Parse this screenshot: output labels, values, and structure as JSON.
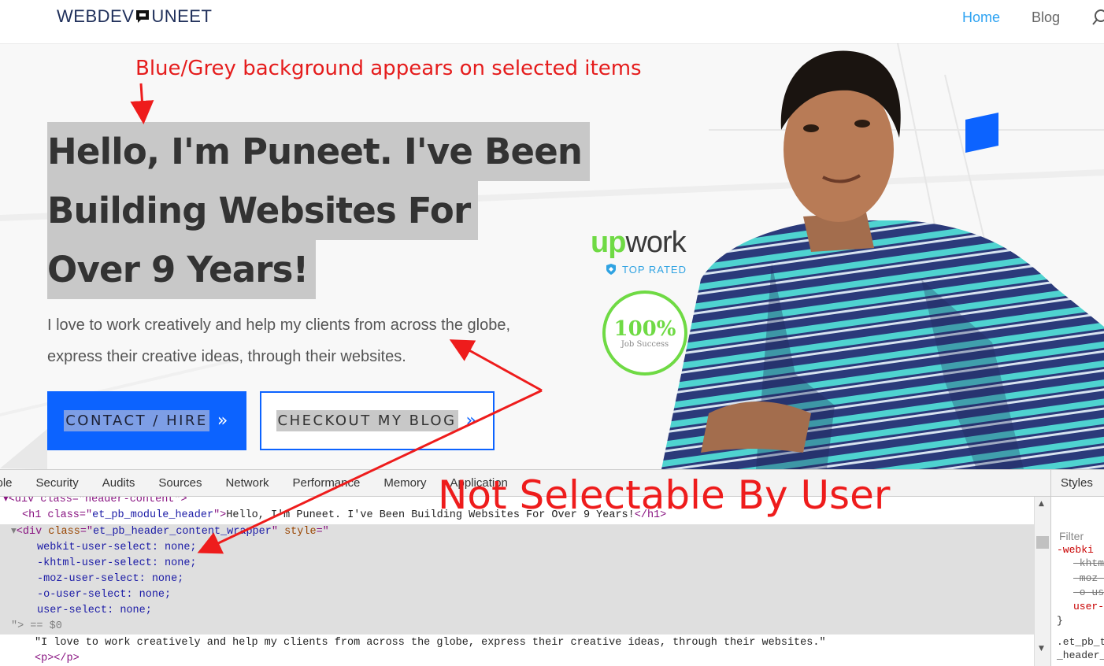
{
  "header": {
    "logo_left": "WEBDEV",
    "logo_right": "UNEET",
    "nav": [
      {
        "label": "Home",
        "active": true
      },
      {
        "label": "Blog",
        "active": false
      }
    ],
    "search_icon": "search-icon"
  },
  "hero": {
    "annotation_top": "Blue/Grey background appears on selected items",
    "headline_lines": [
      "Hello, I'm Puneet. I've Been",
      "Building Websites For",
      "Over 9 Years!"
    ],
    "subtext": "I love to work creatively and help my clients from across the globe, express their creative ideas, through their websites.",
    "buttons": {
      "contact": "CONTACT / HIRE",
      "blog": "CHECKOUT MY BLOG",
      "arrow": "»"
    },
    "badges": {
      "upwork_up": "up",
      "upwork_work": "work",
      "top_rated": "TOP RATED",
      "success_value": "100%",
      "success_label": "Job Success"
    }
  },
  "annotation_big": "Not Selectable By User",
  "devtools": {
    "tabs": [
      "sole",
      "Security",
      "Audits",
      "Sources",
      "Network",
      "Performance",
      "Memory",
      "Application"
    ],
    "lines": {
      "l0": "▾<div class=\"header-content\">",
      "l1_open": "<h1 class=\"",
      "l1_class": "et_pb_module_header",
      "l1_text": "Hello, I'm Puneet. I've Been Building Websites For Over 9 Years!",
      "l1_close": "</h1>",
      "l2_tag": "<div ",
      "l2_attr1": "class",
      "l2_val1": "et_pb_header_content_wrapper",
      "l2_attr2": "style",
      "css": [
        "webkit-user-select: none;",
        "-khtml-user-select: none;",
        "-moz-user-select: none;",
        "-o-user-select: none;",
        "user-select: none;"
      ],
      "l8": "\"> == $0",
      "l9": "\"I love to work creatively and help my clients from across the globe, express their creative ideas, through their websites.\"",
      "l10": "<p></p>"
    },
    "styles_tab": "Styles",
    "filter_placeholder": "Filter",
    "styles_lines": [
      "-webki",
      "-khtm",
      "-moz-",
      "-o-us",
      "user-",
      "}",
      ".et_pb_t",
      "_header_"
    ]
  },
  "colors": {
    "accent_blue": "#0c63ff",
    "nav_active": "#2ea3f2",
    "annotation_red": "#e51c1c",
    "upwork_green": "#6fda44",
    "selection_grey": "#c8c8c8"
  }
}
